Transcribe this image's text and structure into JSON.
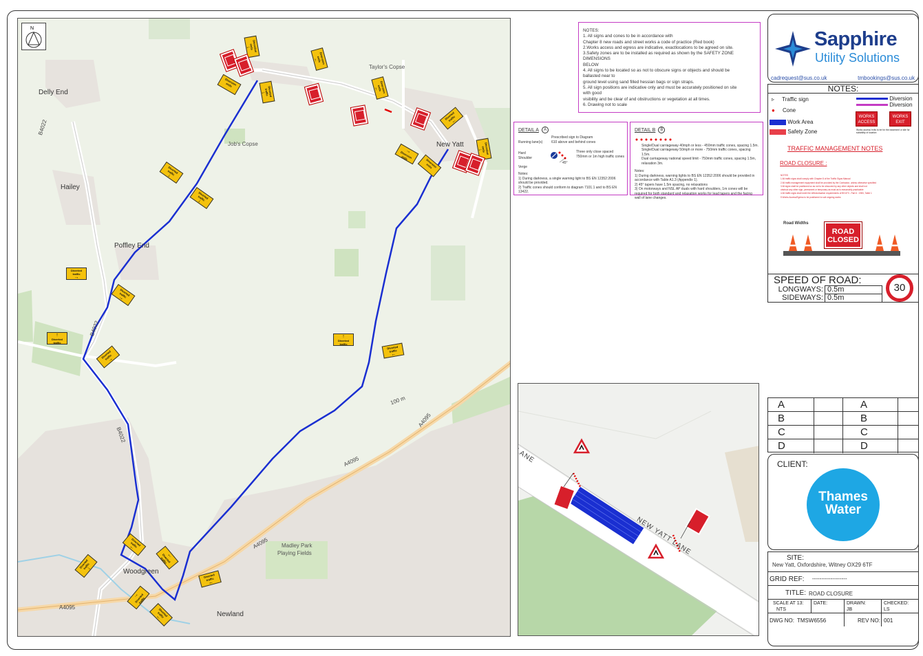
{
  "map": {
    "places": {
      "delly_end": "Delly End",
      "hailey": "Hailey",
      "poffley_end": "Poffley End",
      "jobs_copse": "Job's Copse",
      "taylors_copse": "Taylor's Copse",
      "new_yatt": "New Yatt",
      "woodgreen": "Woodgreen",
      "newland": "Newland",
      "madley_park": "Madley Park",
      "playing_fields": "Playing Fields"
    },
    "roads": {
      "b4022": "B4022",
      "a4095": "A4095",
      "contour": "100 m"
    },
    "signs": {
      "diverted_traffic": "Diverted traffic",
      "diversion_ends": "Diversion ends",
      "road_closed": "Road closed"
    },
    "route_color": "#1a2fd1"
  },
  "notes": {
    "lines": [
      "NOTES:",
      "1. All signs and cones to be in accordance with",
      "Chapter 8 new roads and street works a code of practice (Red book)",
      "2.Works access and egress are indicative, exactlocations to be agreed on site.",
      "3.Safety zones are to be installed as required as shown by the SAFETY ZONE",
      "DIMENSIONS",
      "BELOW",
      "4. All signs to be located so as not to obscure signs or objects and should be",
      "ballasted near to",
      "ground level using sand filled hessian bags or sign straps.",
      "5. All sign positions are indicative only and must be accurately positioned on site",
      "with good",
      "visibility and be clear of and obstructions or vegetation at all times.",
      "6. Drawing not to scale"
    ]
  },
  "detail_a": {
    "title": "DETAIL A",
    "badge": "A",
    "label_running": "Running lane(s)",
    "label_hard": "Hard Shoulder",
    "label_verge": "Verge",
    "label_prescribed": "Prescribed sign to Diagram 610 above and behind cones",
    "label_three": "Three only close spaced 750mm or 1m high traffic cones",
    "angle": "45°",
    "notes_title": "Notes:",
    "note1": "1) During darkness, a single warning light to BS EN 12352:2006 should be provided.",
    "note2": "2) Traffic cones should conform to diagram 7101.1 and to BS EN 13422."
  },
  "detail_b": {
    "title": "DETAIL B",
    "badge": "B",
    "text1": "Single/Dual carriageway 40mph or less - 450mm traffic cones, spacing 1.5m.",
    "text2": "Single/Dual carriageway 50mph or more - 750mm traffic cones, spacing 1.5m.",
    "text3": "Dual carriageway national speed limit - 750mm traffic cones, spacing 1.5m, relaxation 3m.",
    "notes_title": "Notes:",
    "note1": "1) During darkness, warning lights to BS EN 12352:2006 should be provided in accordance with Table A1.3 (Appendix 1).",
    "note2": "2) 45° tapers have 1.5m spacing, no relaxations",
    "note3": "3) On motorways and NSL AP duals with hard shoulders, 1m cones will be required for both standard and relaxation works for lead tapers and the facing wall of lane changes."
  },
  "inset": {
    "road_label": "NEW YATT LANE",
    "road_label_left": "LANE"
  },
  "title_block": {
    "brand": "Sapphire",
    "brand_sub": "Utility Solutions",
    "email_left": "cadrequest@sus.co.uk",
    "email_right": "tmbookings@sus.co.uk",
    "notes_title": "NOTES:",
    "legend": {
      "traffic_sign": "Traffic sign",
      "cone": "Cone",
      "work_area": "Work Area",
      "safety_zone": "Safety Zone",
      "diversion1": "Diversion",
      "diversion2": "Diversion",
      "works_access": "WORKS ACCESS",
      "works_exit": "WORKS EXIT",
      "access_note": "Works access/ exits to be for the easement or site for suitability of location"
    },
    "tm_title": "TRAFFIC MANAGEMENT NOTES",
    "road_closure_label": "ROAD CLOSURE :",
    "red_notes": [
      "NOTES",
      "1   All traffic signs shall comply with Chapter 8 of the Traffic Signs Manual",
      "2   All traffic management equipment shall be provided by the Contractor, unless otherwise specified",
      "3   All signs shall be positioned so as not to be obscured by any other objects and shall not",
      "     obstruct any other sign, permanent or temporary as must as is reasonably practicable",
      "4   All traffic signs shall meet the reflectorisation requirements of BS 873 - Part 6 : 1983, Table 1",
      "5   Works Access/Egress to be positioned to suit ongoing works"
    ],
    "road_widths": "Road Widths",
    "road_closed_sign": "ROAD CLOSED",
    "speed_title": "SPEED OF ROAD:",
    "longways_label": "LONGWAYS:",
    "longways_value": "0.5m",
    "sideways_label": "SIDEWAYS:",
    "sideways_value": "0.5m",
    "speed_limit": "30",
    "revisions": [
      "A",
      "B",
      "C",
      "D"
    ],
    "client_label": "CLIENT:",
    "client_name_1": "Thames",
    "client_name_2": "Water",
    "site_label": "SITE:",
    "site_value": "New Yatt, Oxfordshire, Witney OX29 6TF",
    "grid_label": "GRID REF:",
    "grid_value": "-------------------",
    "title_label": "TITLE:",
    "title_value": "ROAD CLOSURE",
    "scale_label": "SCALE AT 13:",
    "scale_value": "NTS",
    "date_label": "DATE:",
    "date_value": "",
    "drawn_label": "DRAWN:",
    "drawn_value": "JB",
    "checked_label": "CHECKED:",
    "checked_value": "LS",
    "dwg_label": "DWG NO:",
    "dwg_value": "TMSW6556",
    "rev_label": "REV NO:",
    "rev_value": "001"
  }
}
